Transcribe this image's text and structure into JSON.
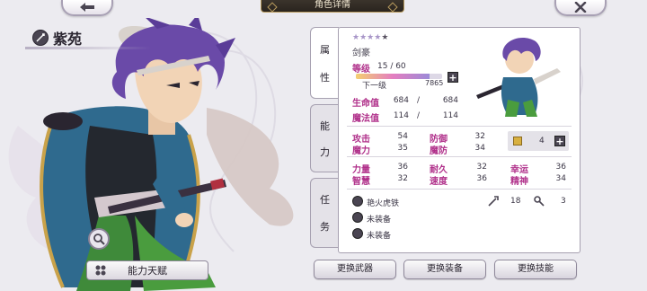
{
  "header": {
    "title": "角色详情",
    "back_icon": "arrow-left-icon",
    "close_icon": "close-icon"
  },
  "character": {
    "name": "紫苑",
    "stars_filled": 4,
    "stars_total": 5,
    "job": "剑豪",
    "level_label": "等级",
    "level_value": "15 / 60",
    "exp_fraction": 0.85,
    "next_label": "下一级",
    "next_value": "7865"
  },
  "tabs": [
    {
      "chars": [
        "属",
        "性"
      ]
    },
    {
      "chars": [
        "能",
        "力"
      ]
    },
    {
      "chars": [
        "任",
        "务"
      ]
    }
  ],
  "vitals": {
    "hp_label": "生命值",
    "hp_cur": "684",
    "hp_max": "684",
    "mp_label": "魔法值",
    "mp_cur": "114",
    "mp_max": "114",
    "slash": "/"
  },
  "stats": {
    "atk_label": "攻击",
    "atk": "54",
    "def_label": "防御",
    "def": "32",
    "mag_label": "魔力",
    "mag": "35",
    "mdef_label": "魔防",
    "mdef": "34",
    "resource_value": "4",
    "str_label": "力量",
    "str": "36",
    "end_label": "耐久",
    "end": "32",
    "luck_label": "幸运",
    "luck": "36",
    "wis_label": "智慧",
    "wis": "32",
    "spd_label": "速度",
    "spd": "36",
    "spi_label": "精神",
    "spi": "34"
  },
  "equipment": {
    "weapon": "艳火虎铁",
    "slot2": "未装备",
    "slot3": "未装备",
    "weapon_atk": "18",
    "weapon_other": "3"
  },
  "buttons": {
    "talent": "能力天赋",
    "change_weapon": "更换武器",
    "change_equip": "更换装备",
    "change_skill": "更换技能"
  },
  "colors": {
    "accent": "#b0308a",
    "panel_border": "#a6a0b0"
  }
}
